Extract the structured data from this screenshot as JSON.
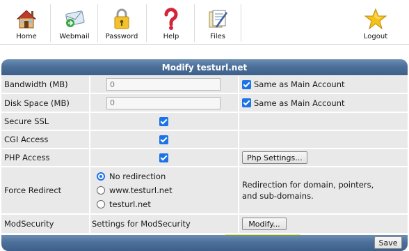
{
  "toolbar": {
    "items": [
      {
        "label": "Home",
        "icon": "home-icon"
      },
      {
        "label": "Webmail",
        "icon": "mail-icon"
      },
      {
        "label": "Password",
        "icon": "padlock-icon"
      },
      {
        "label": "Help",
        "icon": "help-icon"
      },
      {
        "label": "Files",
        "icon": "files-icon"
      },
      {
        "label": "Logout",
        "icon": "star-icon"
      }
    ]
  },
  "header": {
    "title": "Modify testurl.net"
  },
  "rows": {
    "bandwidth": {
      "label": "Bandwidth (MB)",
      "value": "0",
      "same_label": "Same as Main Account",
      "same_checked": true
    },
    "disk": {
      "label": "Disk Space (MB)",
      "value": "0",
      "same_label": "Same as Main Account",
      "same_checked": true
    },
    "ssl": {
      "label": "Secure SSL",
      "checked": true
    },
    "cgi": {
      "label": "CGI Access",
      "checked": true
    },
    "php": {
      "label": "PHP Access",
      "checked": true,
      "button": "Php Settings..."
    },
    "redirect": {
      "label": "Force Redirect",
      "options": [
        "No redirection",
        "www.testurl.net",
        "testurl.net"
      ],
      "selected": "No redirection",
      "note_line1": "Redirection for domain, pointers,",
      "note_line2": "and sub-domains."
    },
    "modsec": {
      "label": "ModSecurity",
      "text": "Settings for ModSecurity",
      "button": "Modify..."
    }
  },
  "footer": {
    "save_label": "Save"
  },
  "colors": {
    "header_blue": "#4c709a",
    "checkbox_blue": "#1a73e8",
    "highlight": "#ecf400",
    "row_grey": "#e9e9e9"
  }
}
